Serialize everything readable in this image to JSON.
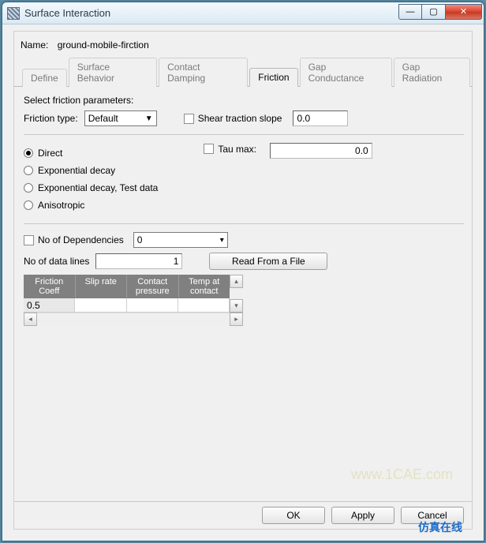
{
  "window": {
    "title": "Surface Interaction"
  },
  "name_row": {
    "label": "Name:",
    "value": "ground-mobile-firction"
  },
  "tabs": {
    "items": [
      {
        "label": "Define"
      },
      {
        "label": "Surface Behavior"
      },
      {
        "label": "Contact Damping"
      },
      {
        "label": "Friction"
      },
      {
        "label": "Gap Conductance"
      },
      {
        "label": "Gap Radiation"
      }
    ],
    "active_index": 3
  },
  "friction_page": {
    "select_params_label": "Select friction parameters:",
    "friction_type_label": "Friction type:",
    "friction_type_value": "Default",
    "shear_label": "Shear traction slope",
    "shear_value": "0.0",
    "mode_options": [
      "Direct",
      "Exponential decay",
      "Exponential decay, Test data",
      "Anisotropic"
    ],
    "mode_selected_index": 0,
    "tau_label": "Tau max:",
    "tau_value": "0.0",
    "dep_label": "No of Dependencies",
    "dep_value": "0",
    "lines_label": "No of data lines",
    "lines_value": "1",
    "read_button": "Read From a File",
    "table": {
      "headers": [
        "Friction Coeff",
        "Slip rate",
        "Contact pressure",
        "Temp at contact"
      ],
      "rows": [
        [
          "0.5",
          "",
          "",
          ""
        ]
      ]
    }
  },
  "buttons": {
    "ok": "OK",
    "apply": "Apply",
    "cancel": "Cancel"
  },
  "watermarks": {
    "site": "www.1CAE.com",
    "cn": "仿真在线"
  }
}
